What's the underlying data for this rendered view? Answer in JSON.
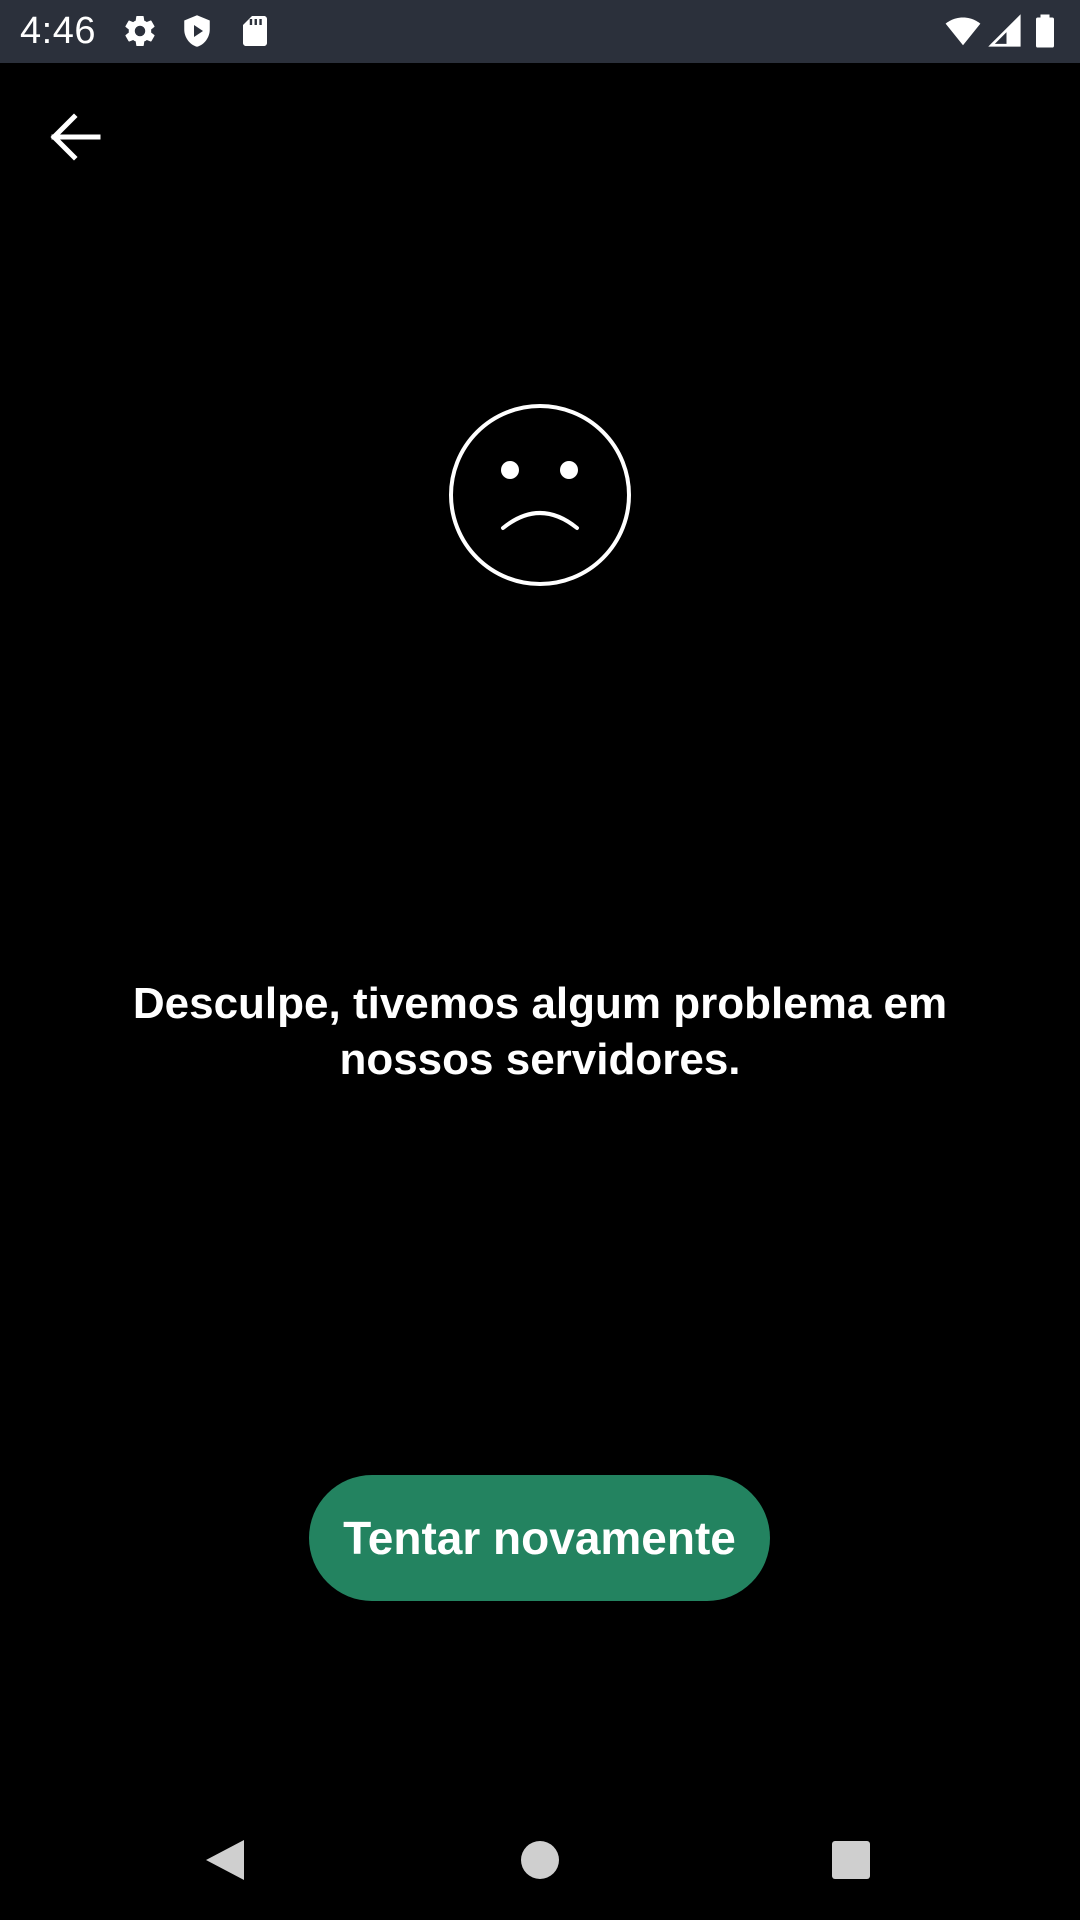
{
  "status_bar": {
    "time": "4:46",
    "left_icons": [
      "gear-icon",
      "shield-icon",
      "sd-card-icon"
    ],
    "right_icons": [
      "wifi-icon",
      "signal-icon",
      "battery-icon"
    ],
    "background_color": "#2b303b"
  },
  "app_bar": {
    "back_icon": "arrow-back-icon"
  },
  "content": {
    "illustration_icon": "sad-face-icon",
    "error_message": "Desculpe, tivemos algum problema em nossos servidores.",
    "retry_label": "Tentar novamente"
  },
  "colors": {
    "background": "#000000",
    "accent": "#238360",
    "text": "#ffffff"
  },
  "nav_bar": {
    "buttons": [
      "back-triangle-icon",
      "home-circle-icon",
      "recents-square-icon"
    ]
  }
}
